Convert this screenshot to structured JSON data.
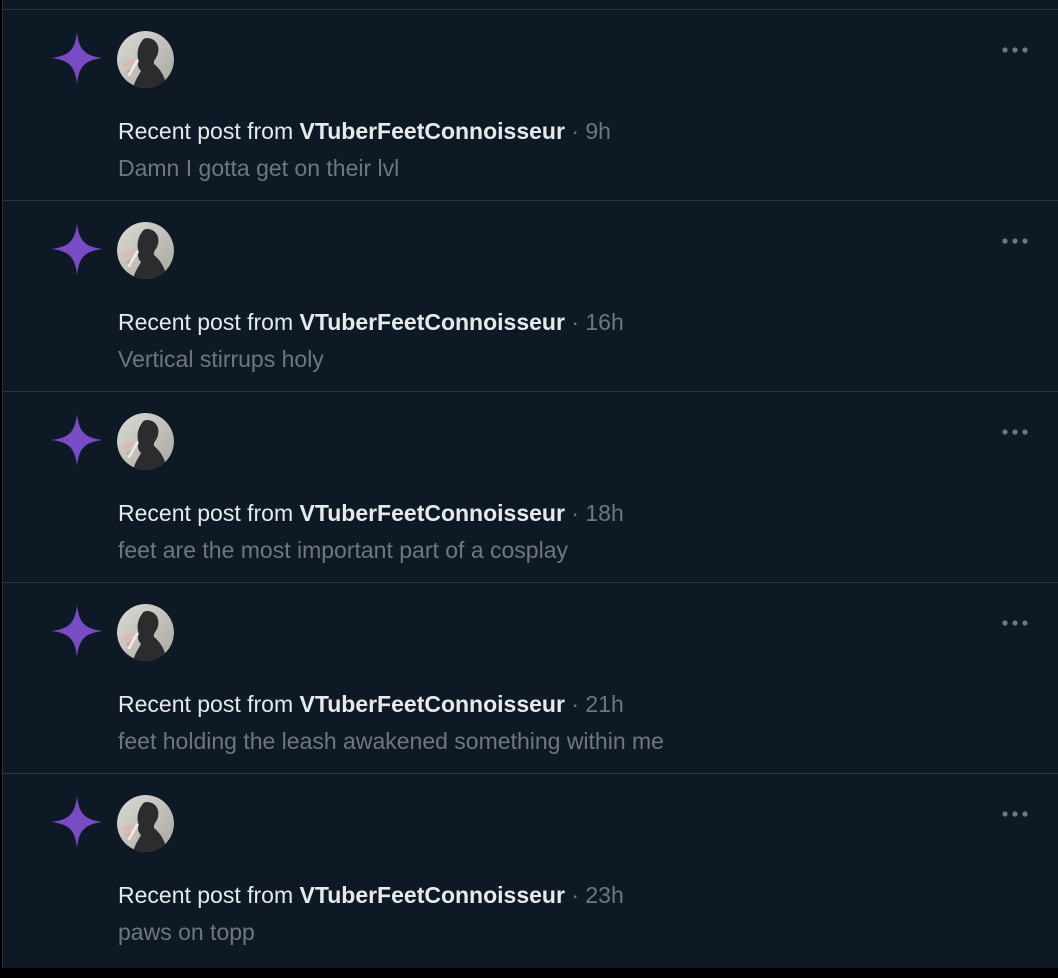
{
  "colors": {
    "background": "#0d1a25",
    "divider": "#2a3541",
    "star": "#794bc4",
    "primary_text": "#e7e9ea",
    "secondary_text": "#71767b"
  },
  "icons": {
    "star": "sparkle-star-icon",
    "more": "more-horizontal-icon"
  },
  "notifications": [
    {
      "prefix": "Recent post from",
      "username": "VTuberFeetConnoisseur",
      "separator": "·",
      "time": "9h",
      "text": "Damn I gotta get on their lvl"
    },
    {
      "prefix": "Recent post from",
      "username": "VTuberFeetConnoisseur",
      "separator": "·",
      "time": "16h",
      "text": "Vertical stirrups holy"
    },
    {
      "prefix": "Recent post from",
      "username": "VTuberFeetConnoisseur",
      "separator": "·",
      "time": "18h",
      "text": "feet are the most important part of a cosplay"
    },
    {
      "prefix": "Recent post from",
      "username": "VTuberFeetConnoisseur",
      "separator": "·",
      "time": "21h",
      "text": "feet holding the leash awakened something within me"
    },
    {
      "prefix": "Recent post from",
      "username": "VTuberFeetConnoisseur",
      "separator": "·",
      "time": "23h",
      "text": "paws on topp"
    }
  ]
}
